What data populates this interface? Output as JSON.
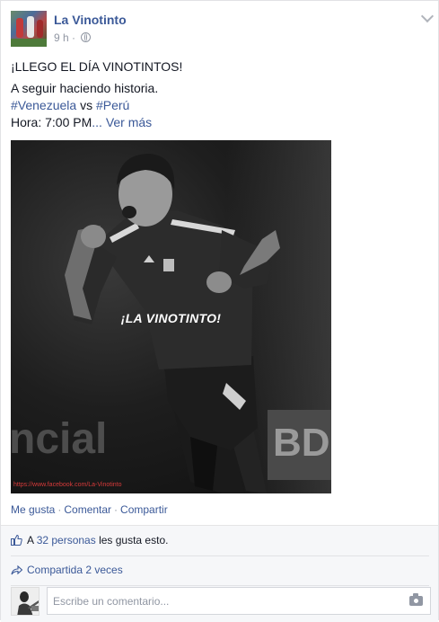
{
  "post": {
    "page_name": "La Vinotinto",
    "time": "9 h",
    "meta_separator": "·",
    "line1": "¡LLEGO EL DÍA VINOTINTOS!",
    "line2": "A seguir haciendo historia.",
    "hashtag1": "#Venezuela",
    "vs": " vs ",
    "hashtag2": "#Perú",
    "hora_prefix": "Hora: 7:00 PM",
    "ellipsis": "...",
    "ver_mas": "Ver más"
  },
  "photo": {
    "overlay_text": "¡LA VINOTINTO!",
    "watermark": "https://www.facebook.com/La-Vinotinto",
    "ad_left": "ncial",
    "ad_right": "BD"
  },
  "actions": {
    "like": "Me gusta",
    "comment": "Comentar",
    "share": "Compartir",
    "separator": "·"
  },
  "footer": {
    "likes_prefix": "A ",
    "likes_count": "32 personas",
    "likes_suffix": " les gusta esto.",
    "shares": "Compartida 2 veces",
    "comment_placeholder": "Escribe un comentario..."
  },
  "colors": {
    "link": "#3b5998",
    "text": "#141823",
    "muted": "#9197a3",
    "footer_bg": "#f6f7f9"
  },
  "icons": [
    "globe-icon",
    "chevron-down-icon",
    "thumbs-up-icon",
    "share-arrow-icon",
    "camera-icon"
  ]
}
